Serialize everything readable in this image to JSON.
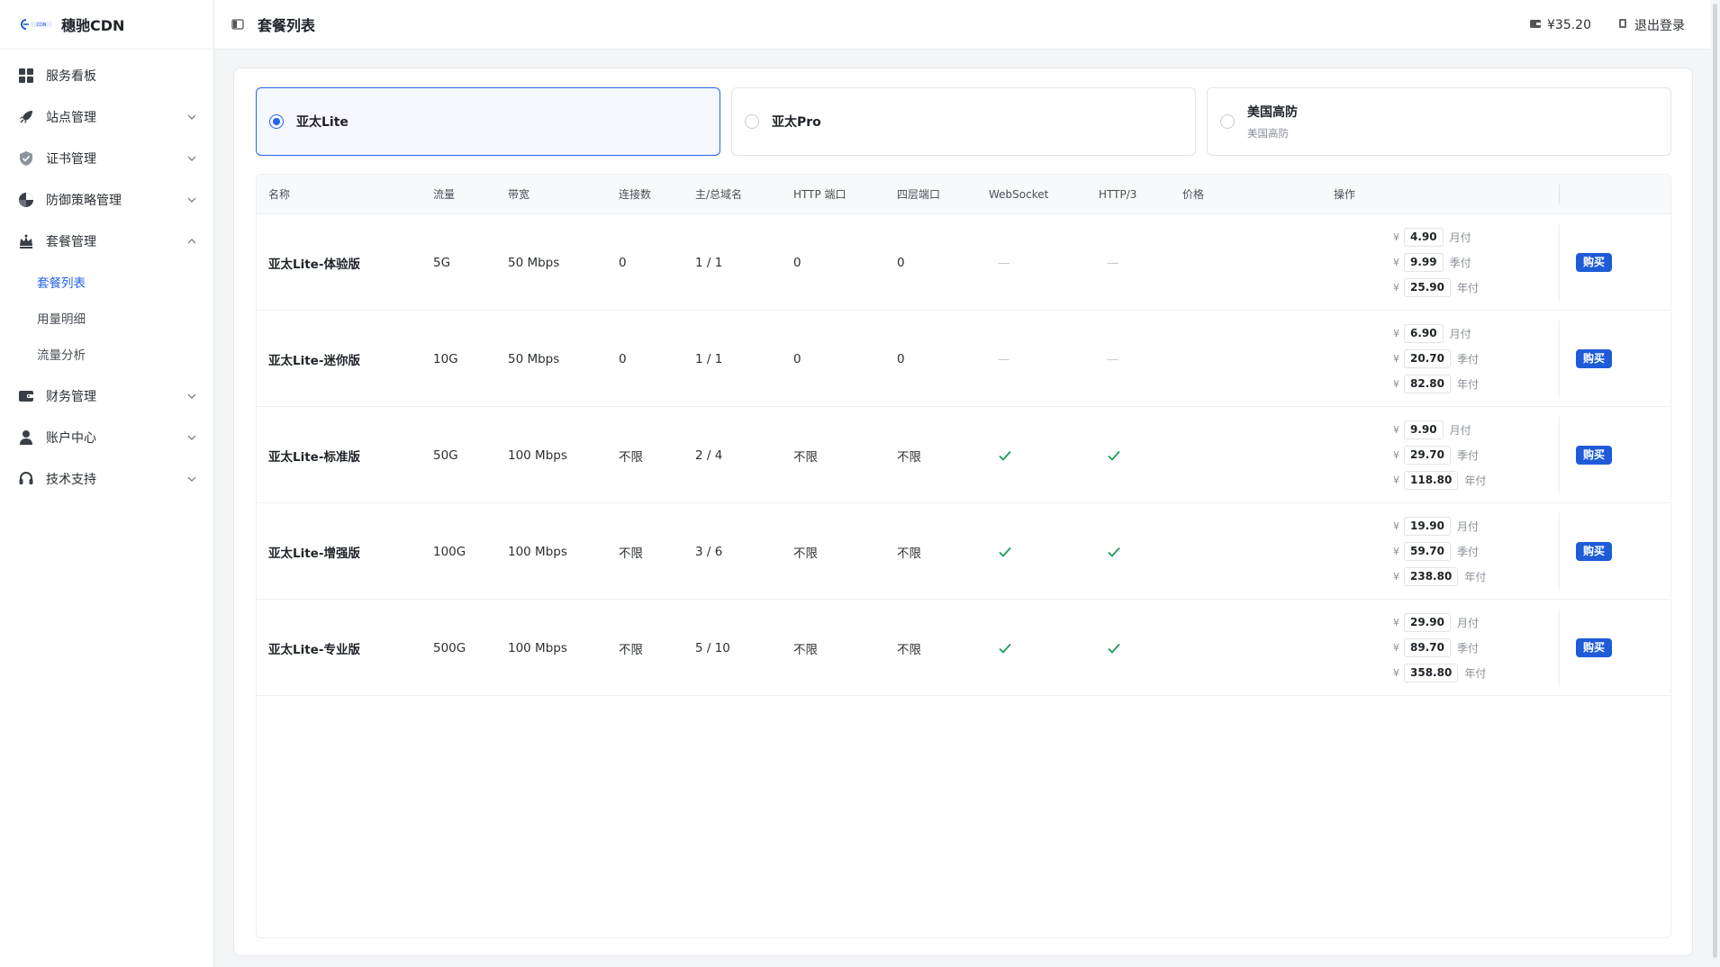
{
  "brand": {
    "logo_text": "CDN",
    "name": "穗驰CDN"
  },
  "sidebar": {
    "items": [
      {
        "label": "服务看板",
        "icon": "dashboard-icon",
        "expandable": false
      },
      {
        "label": "站点管理",
        "icon": "rocket-icon",
        "expandable": true
      },
      {
        "label": "证书管理",
        "icon": "shield-check-icon",
        "expandable": true
      },
      {
        "label": "防御策略管理",
        "icon": "defense-icon",
        "expandable": true
      },
      {
        "label": "套餐管理",
        "icon": "crown-icon",
        "expandable": true,
        "expanded": true,
        "children": [
          {
            "label": "套餐列表",
            "active": true
          },
          {
            "label": "用量明细",
            "active": false
          },
          {
            "label": "流量分析",
            "active": false
          }
        ]
      },
      {
        "label": "财务管理",
        "icon": "wallet-icon",
        "expandable": true
      },
      {
        "label": "账户中心",
        "icon": "user-icon",
        "expandable": true
      },
      {
        "label": "技术支持",
        "icon": "headset-icon",
        "expandable": true
      }
    ]
  },
  "header": {
    "title": "套餐列表",
    "balance": "¥35.20",
    "logout": "退出登录"
  },
  "plans": [
    {
      "name": "亚太Lite",
      "sub": "",
      "selected": true
    },
    {
      "name": "亚太Pro",
      "sub": "",
      "selected": false
    },
    {
      "name": "美国高防",
      "sub": "美国高防",
      "selected": false
    }
  ],
  "table": {
    "columns": [
      "名称",
      "流量",
      "带宽",
      "连接数",
      "主/总域名",
      "HTTP 端口",
      "四层端口",
      "WebSocket",
      "HTTP/3",
      "价格",
      "操作"
    ],
    "buy_label": "购买",
    "currency": "¥",
    "periods": [
      "月付",
      "季付",
      "年付"
    ],
    "rows": [
      {
        "name": "亚太Lite-体验版",
        "traffic": "5G",
        "bandwidth": "50 Mbps",
        "connections": "0",
        "domains": "1 / 1",
        "http_ports": "0",
        "l4_ports": "0",
        "websocket": "—",
        "http3": "—",
        "prices": [
          "4.90",
          "9.99",
          "25.90"
        ]
      },
      {
        "name": "亚太Lite-迷你版",
        "traffic": "10G",
        "bandwidth": "50 Mbps",
        "connections": "0",
        "domains": "1 / 1",
        "http_ports": "0",
        "l4_ports": "0",
        "websocket": "—",
        "http3": "—",
        "prices": [
          "6.90",
          "20.70",
          "82.80"
        ]
      },
      {
        "name": "亚太Lite-标准版",
        "traffic": "50G",
        "bandwidth": "100 Mbps",
        "connections": "不限",
        "domains": "2 / 4",
        "http_ports": "不限",
        "l4_ports": "不限",
        "websocket": "check",
        "http3": "check",
        "prices": [
          "9.90",
          "29.70",
          "118.80"
        ]
      },
      {
        "name": "亚太Lite-增强版",
        "traffic": "100G",
        "bandwidth": "100 Mbps",
        "connections": "不限",
        "domains": "3 / 6",
        "http_ports": "不限",
        "l4_ports": "不限",
        "websocket": "check",
        "http3": "check",
        "prices": [
          "19.90",
          "59.70",
          "238.80"
        ]
      },
      {
        "name": "亚太Lite-专业版",
        "traffic": "500G",
        "bandwidth": "100 Mbps",
        "connections": "不限",
        "domains": "5 / 10",
        "http_ports": "不限",
        "l4_ports": "不限",
        "websocket": "check",
        "http3": "check",
        "prices": [
          "29.90",
          "89.70",
          "358.80"
        ]
      }
    ]
  },
  "colors": {
    "primary": "#2563eb",
    "buy": "#1f5bd8",
    "check": "#1a9b5a"
  }
}
